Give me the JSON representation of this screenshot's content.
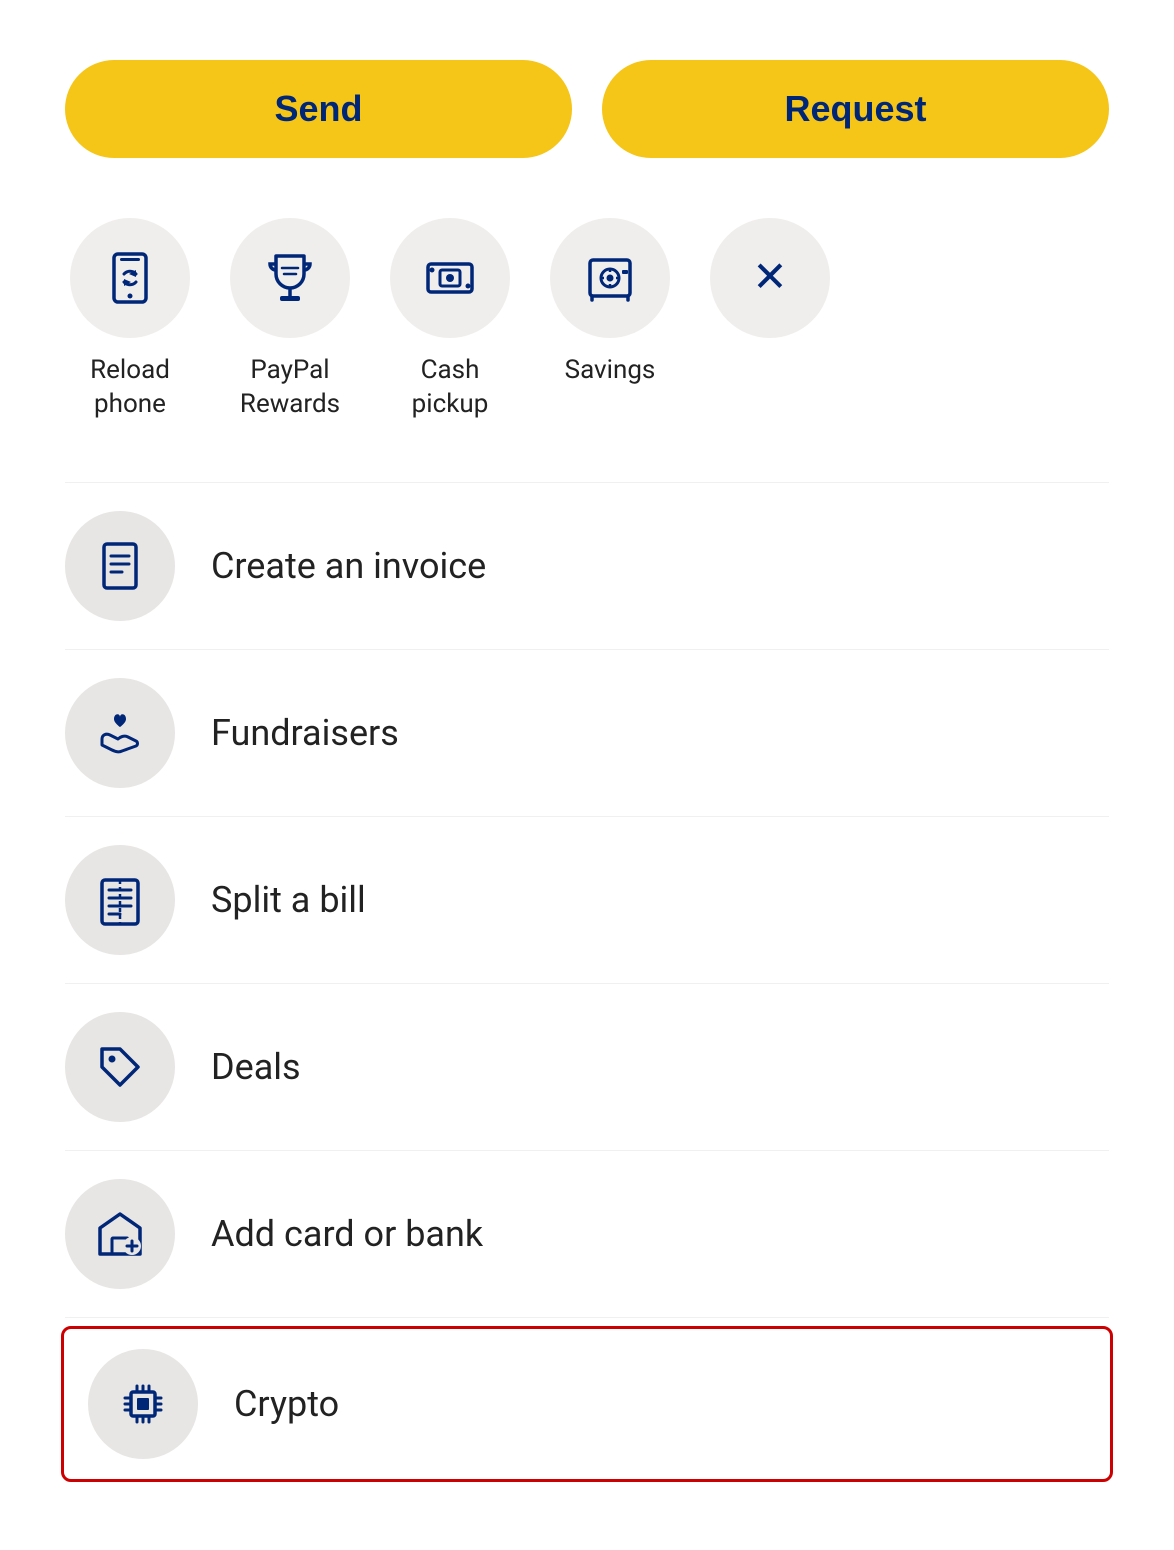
{
  "buttons": {
    "send_label": "Send",
    "request_label": "Request"
  },
  "quick_actions": [
    {
      "id": "reload-phone",
      "label": "Reload\nphone",
      "icon": "reload-phone-icon"
    },
    {
      "id": "paypal-rewards",
      "label": "PayPal\nRewards",
      "icon": "trophy-icon"
    },
    {
      "id": "cash-pickup",
      "label": "Cash\npickup",
      "icon": "cash-pickup-icon"
    },
    {
      "id": "savings",
      "label": "Savings",
      "icon": "savings-icon"
    },
    {
      "id": "close",
      "label": "",
      "icon": "close-icon"
    }
  ],
  "menu_items": [
    {
      "id": "create-invoice",
      "label": "Create an invoice",
      "icon": "invoice-icon"
    },
    {
      "id": "fundraisers",
      "label": "Fundraisers",
      "icon": "fundraisers-icon"
    },
    {
      "id": "split-bill",
      "label": "Split a bill",
      "icon": "split-bill-icon"
    },
    {
      "id": "deals",
      "label": "Deals",
      "icon": "deals-icon"
    },
    {
      "id": "add-card-bank",
      "label": "Add card or bank",
      "icon": "add-card-icon"
    },
    {
      "id": "crypto",
      "label": "Crypto",
      "icon": "crypto-icon",
      "highlighted": true
    }
  ]
}
